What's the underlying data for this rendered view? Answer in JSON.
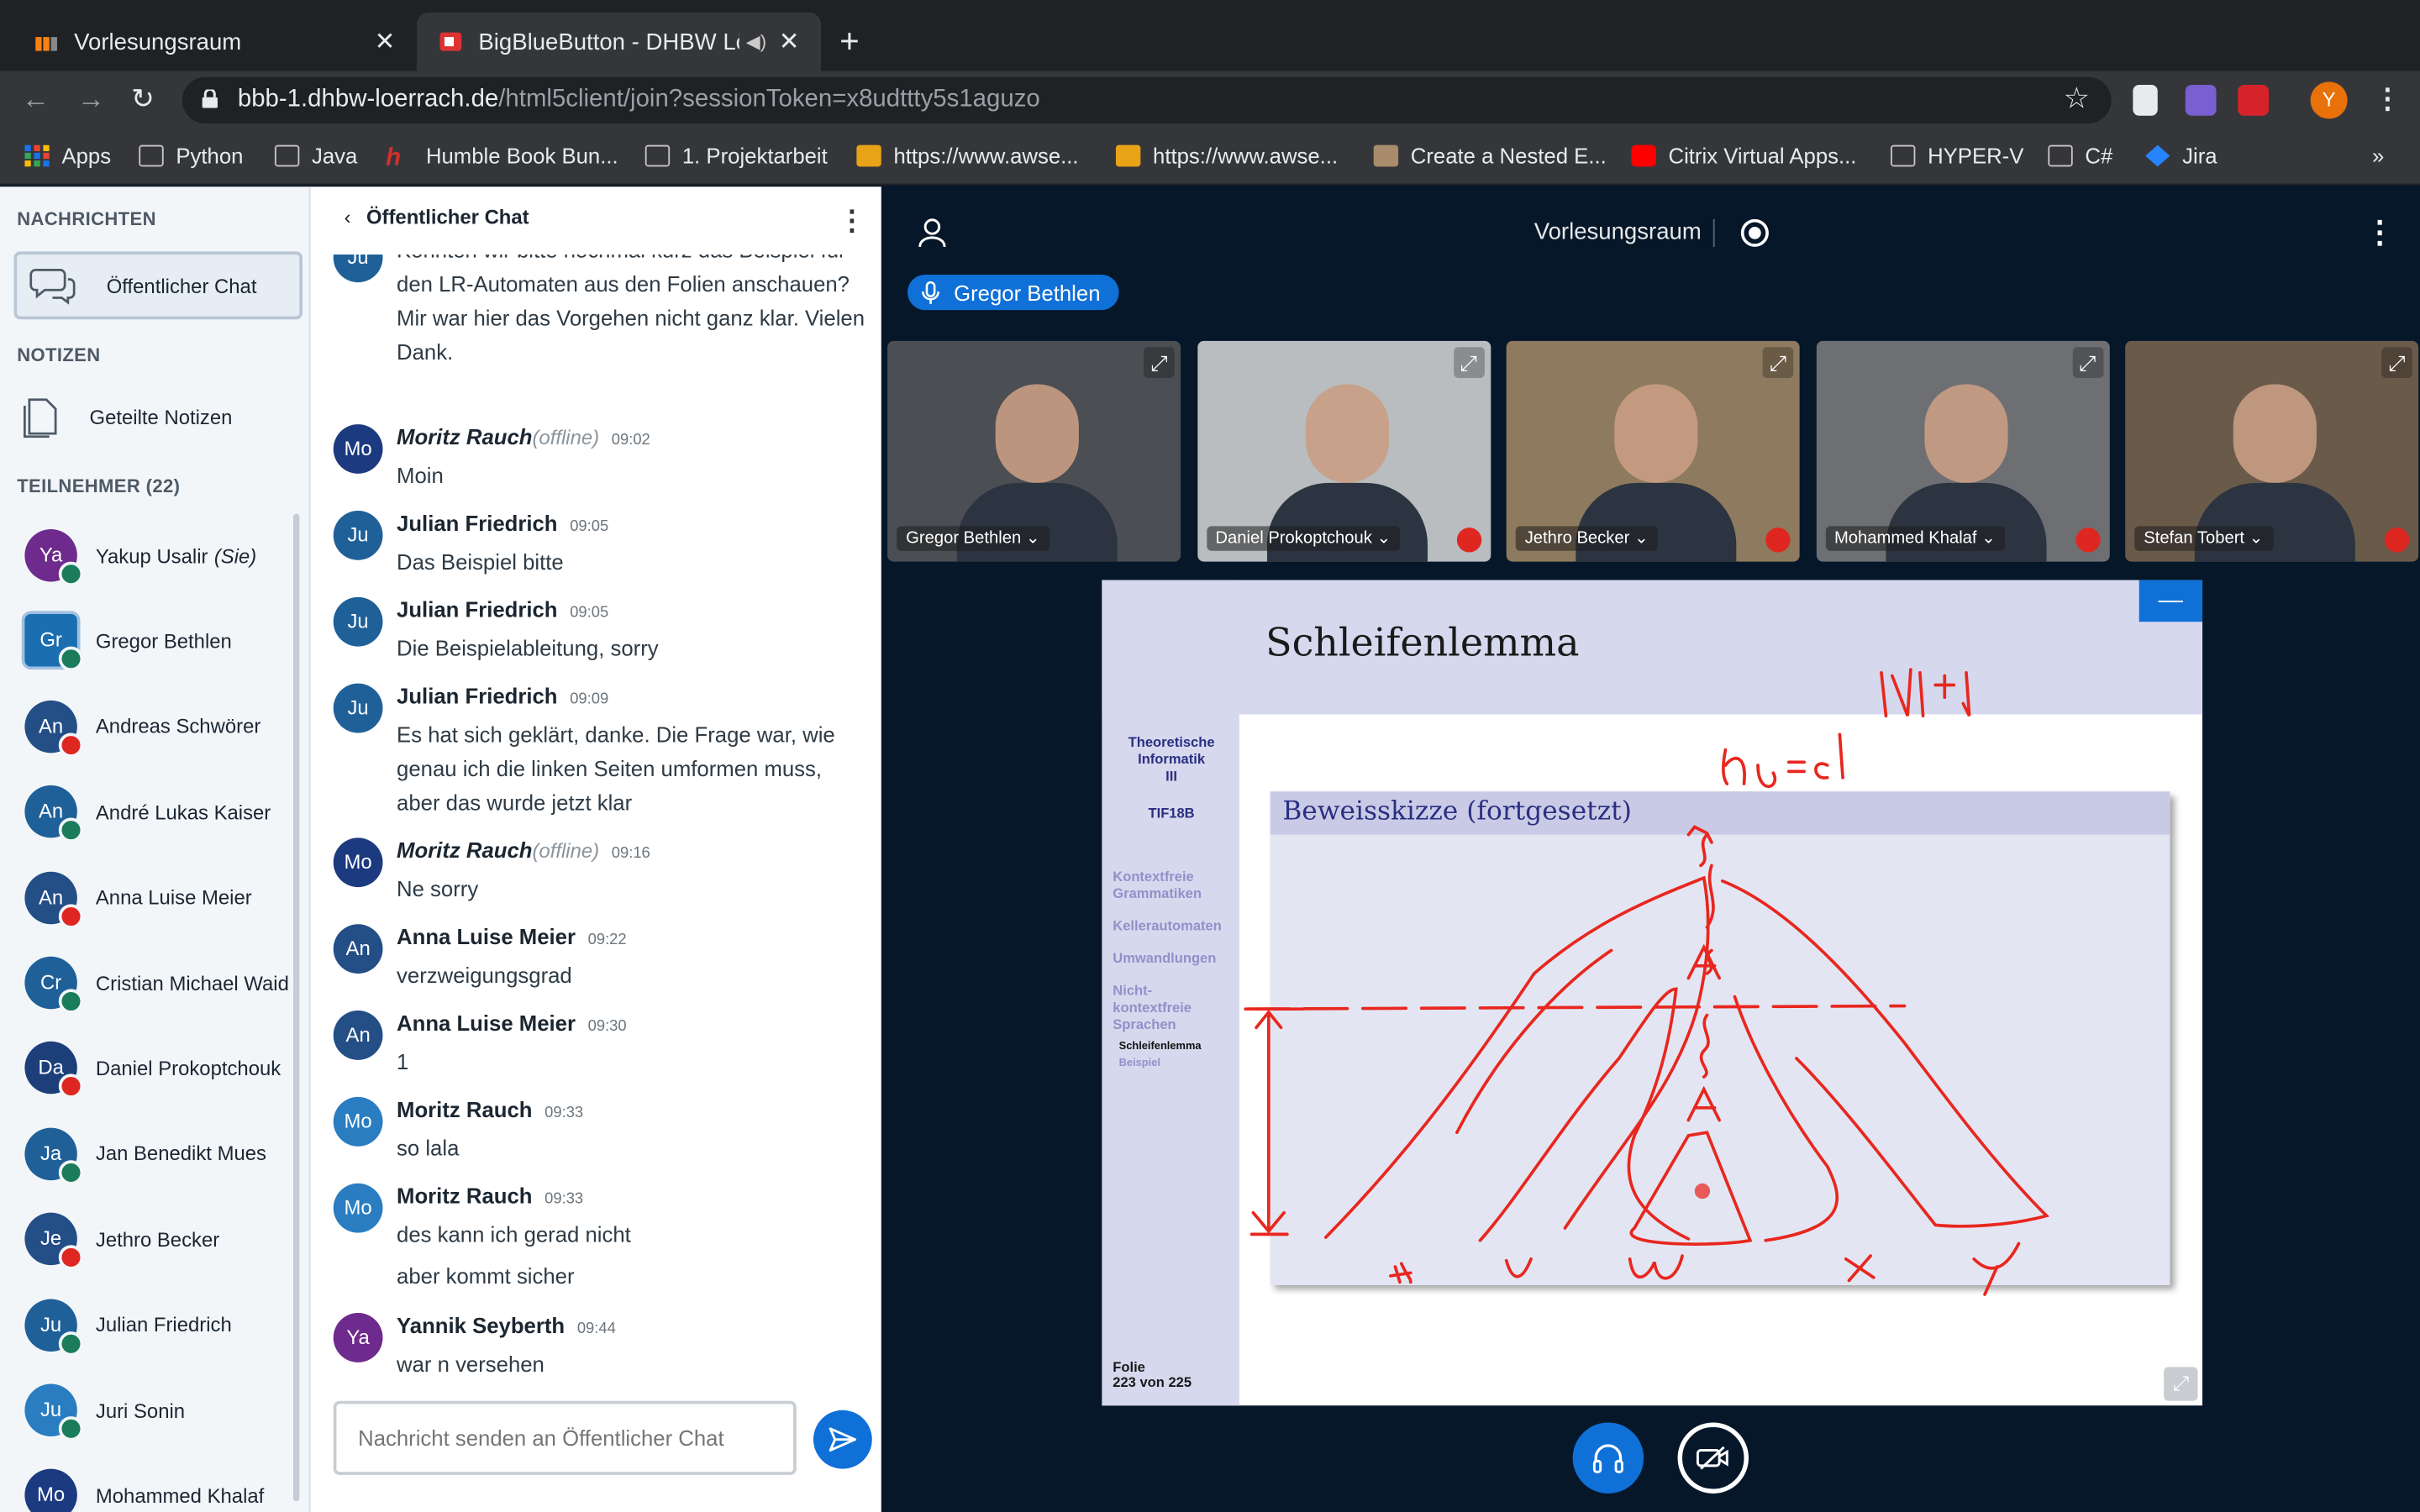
{
  "browser": {
    "tabs": [
      {
        "title": "Vorlesungsraum"
      },
      {
        "title": "BigBlueButton - DHBW Lör"
      }
    ],
    "url_host": "bbb-1.dhbw-loerrach.de",
    "url_path": "/html5client/join?sessionToken=x8udttty5s1aguzo",
    "profile_initial": "Y",
    "bookmarks": [
      "Apps",
      "Python",
      "Java",
      "Humble Book Bun...",
      "1. Projektarbeit",
      "https://www.awse...",
      "https://www.awse...",
      "Create a Nested E...",
      "Citrix Virtual Apps...",
      "HYPER-V",
      "C#",
      "Jira"
    ],
    "more": "»"
  },
  "sidebar": {
    "messages_heading": "NACHRICHTEN",
    "public_chat": "Öffentlicher Chat",
    "notes_heading": "NOTIZEN",
    "shared_notes": "Geteilte Notizen",
    "participants_heading": "TEILNEHMER (22)",
    "users": [
      {
        "initials": "Ya",
        "name": "Yakup Usalir",
        "you": "(Sie)",
        "color": "#6e2a8c",
        "status": "listen"
      },
      {
        "initials": "Gr",
        "name": "Gregor Bethlen",
        "color": "#1b6fb1",
        "status": "listen",
        "presenter": true
      },
      {
        "initials": "An",
        "name": "Andreas Schwörer",
        "color": "#234e86",
        "status": "muted"
      },
      {
        "initials": "An",
        "name": "André Lukas Kaiser",
        "color": "#1f6099",
        "status": "listen"
      },
      {
        "initials": "An",
        "name": "Anna Luise Meier",
        "color": "#234e86",
        "status": "muted"
      },
      {
        "initials": "Cr",
        "name": "Cristian Michael Waid",
        "color": "#1f6099",
        "status": "listen"
      },
      {
        "initials": "Da",
        "name": "Daniel Prokoptchouk",
        "color": "#1c3f7a",
        "status": "muted"
      },
      {
        "initials": "Ja",
        "name": "Jan Benedikt Mues",
        "color": "#1f6099",
        "status": "listen"
      },
      {
        "initials": "Je",
        "name": "Jethro Becker",
        "color": "#234e86",
        "status": "muted"
      },
      {
        "initials": "Ju",
        "name": "Julian Friedrich",
        "color": "#1f6099",
        "status": "listen"
      },
      {
        "initials": "Ju",
        "name": "Juri Sonin",
        "color": "#2a7dc1",
        "status": "listen"
      },
      {
        "initials": "Mo",
        "name": "Mohammed Khalaf",
        "color": "#1c3a80",
        "status": "none"
      }
    ]
  },
  "chat": {
    "back_label": "Öffentlicher Chat",
    "kebab": "⋮",
    "messages": [
      {
        "initials": "Ju",
        "color": "#1f6099",
        "name": "",
        "time": "",
        "offline": false,
        "lines": [
          "Könnten wir bitte nochmal kurz das Beispiel für den LR-Automaten aus den Folien anschauen? Mir war hier das Vorgehen nicht ganz klar. Vielen Dank."
        ]
      },
      {
        "initials": "Mo",
        "color": "#1c3a80",
        "name": "Moritz Rauch",
        "time": "09:02",
        "offline": true,
        "offline_label": "(offline)",
        "lines": [
          "Moin"
        ]
      },
      {
        "initials": "Ju",
        "color": "#1f6099",
        "name": "Julian Friedrich",
        "time": "09:05",
        "offline": false,
        "lines": [
          "Das Beispiel bitte"
        ]
      },
      {
        "initials": "Ju",
        "color": "#1f6099",
        "name": "Julian Friedrich",
        "time": "09:05",
        "offline": false,
        "lines": [
          "Die Beispielableitung, sorry"
        ]
      },
      {
        "initials": "Ju",
        "color": "#1f6099",
        "name": "Julian Friedrich",
        "time": "09:09",
        "offline": false,
        "lines": [
          "Es hat sich geklärt, danke. Die Frage war, wie genau ich die linken Seiten umformen muss, aber das wurde jetzt klar"
        ]
      },
      {
        "initials": "Mo",
        "color": "#1c3a80",
        "name": "Moritz Rauch",
        "time": "09:16",
        "offline": true,
        "offline_label": "(offline)",
        "lines": [
          "Ne sorry"
        ]
      },
      {
        "initials": "An",
        "color": "#234e86",
        "name": "Anna Luise Meier",
        "time": "09:22",
        "offline": false,
        "lines": [
          "verzweigungsgrad"
        ]
      },
      {
        "initials": "An",
        "color": "#234e86",
        "name": "Anna Luise Meier",
        "time": "09:30",
        "offline": false,
        "lines": [
          "1"
        ]
      },
      {
        "initials": "Mo",
        "color": "#2a7dc1",
        "name": "Moritz Rauch",
        "time": "09:33",
        "offline": false,
        "lines": [
          "so lala"
        ]
      },
      {
        "initials": "Mo",
        "color": "#2a7dc1",
        "name": "Moritz Rauch",
        "time": "09:33",
        "offline": false,
        "lines": [
          "des kann ich gerad nicht",
          "aber kommt sicher"
        ]
      },
      {
        "initials": "Ya",
        "color": "#6e2a8c",
        "name": "Yannik Seyberth",
        "time": "09:44",
        "offline": false,
        "lines": [
          "war n versehen"
        ]
      }
    ],
    "input_placeholder": "Nachricht senden an Öffentlicher Chat"
  },
  "main": {
    "title": "Vorlesungsraum",
    "talker": "Gregor Bethlen",
    "videos": [
      {
        "name": "Gregor Bethlen",
        "muted": false,
        "bg": "#4b4e52"
      },
      {
        "name": "Daniel Prokoptchouk",
        "muted": true,
        "bg": "#b9bdc0"
      },
      {
        "name": "Jethro Becker",
        "muted": true,
        "bg": "#8e7a5e"
      },
      {
        "name": "Mohammed Khalaf",
        "muted": true,
        "bg": "#6d6f72"
      },
      {
        "name": "Stefan Tobert",
        "muted": true,
        "bg": "#6a5a4a"
      }
    ],
    "slide": {
      "title": "Schleifenlemma",
      "sidebar_title": [
        "Theoretische",
        "Informatik",
        "III"
      ],
      "course": "TIF18B",
      "toc": [
        "Kontextfreie Grammatiken",
        "Kellerautomaten",
        "Umwandlungen",
        "Nicht-kontextfreie Sprachen"
      ],
      "toc_sub": [
        "Schleifenlemma",
        "Beispiel"
      ],
      "box_title": "Beweisskizze (fortgesetzt)",
      "footer": [
        "Folie",
        "223 von 225"
      ],
      "annotations": [
        "|N|+1",
        "n₀ := d",
        "S",
        "A",
        "A",
        "u",
        "v",
        "w",
        "x",
        "y"
      ]
    }
  }
}
